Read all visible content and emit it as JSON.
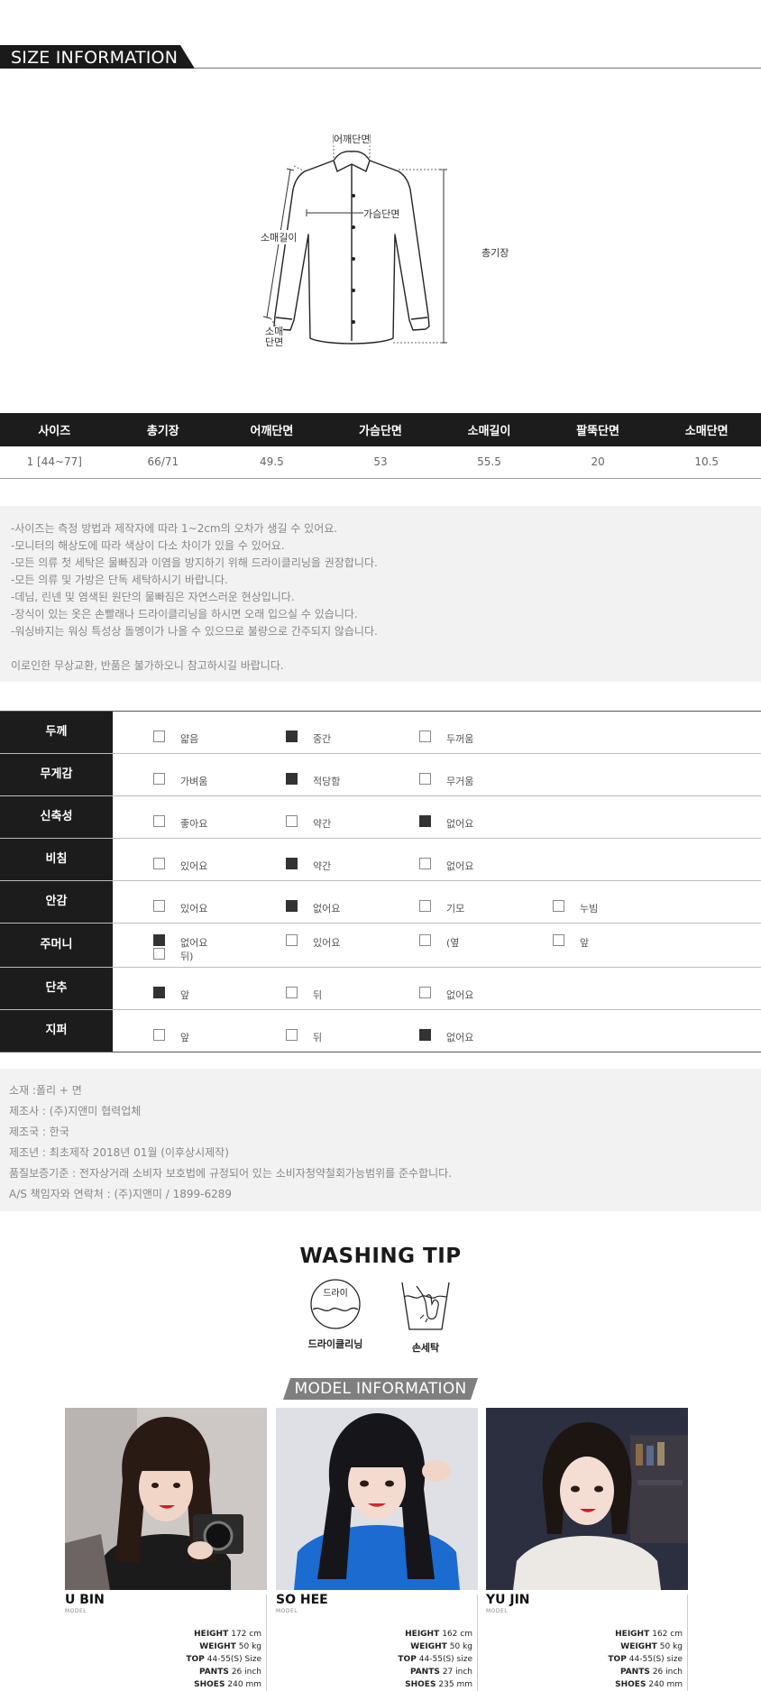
{
  "size_section": {
    "title": "SIZE INFORMATION",
    "diagram_labels": {
      "shoulder": "어깨단면",
      "chest": "가슴단면",
      "sleeve_length": "소매길이",
      "total_length": "총기장",
      "cuff": "소매\n단면"
    }
  },
  "size_table": {
    "headers": [
      "사이즈",
      "총기장",
      "어깨단면",
      "가슴단면",
      "소매길이",
      "팔뚝단면",
      "소매단면"
    ],
    "rows": [
      [
        "1 [44~77]",
        "66/71",
        "49.5",
        "53",
        "55.5",
        "20",
        "10.5"
      ]
    ]
  },
  "notes": {
    "lines": [
      "-사이즈는 측정 방법과 제작자에 따라 1~2cm의 오차가 생길 수 있어요.",
      "-모니터의 해상도에 따라 색상이 다소 차이가 있을 수 있어요.",
      "-모든 의류 첫 세탁은 물빠짐과 이염을 방지하기 위해 드라이클리닝을 권장합니다.",
      "-모든 의류 및 가방은 단독 세탁하시기 바랍니다.",
      "-데님, 린넨 및 염색된 원단의 물빠짐은 자연스러운 현상입니다.",
      "-장식이 있는 옷은 손빨래나 드라이클리닝을 하시면 오래 입으실 수 있습니다.",
      "-워싱바지는 워싱 특성상 돌멩이가 나올 수 있으므로 불량으로 간주되지 않습니다."
    ],
    "closing": "이로인한 무상교환, 반품은 불가하오니 참고하시길 바랍니다."
  },
  "attributes": [
    {
      "label": "두께",
      "options": [
        {
          "text": "얇음",
          "checked": false
        },
        {
          "text": "중간",
          "checked": true
        },
        {
          "text": "두꺼움",
          "checked": false
        }
      ]
    },
    {
      "label": "무게감",
      "options": [
        {
          "text": "가벼움",
          "checked": false
        },
        {
          "text": "적당함",
          "checked": true
        },
        {
          "text": "무거움",
          "checked": false
        }
      ]
    },
    {
      "label": "신축성",
      "options": [
        {
          "text": "좋아요",
          "checked": false
        },
        {
          "text": "약간",
          "checked": false
        },
        {
          "text": "없어요",
          "checked": true
        }
      ]
    },
    {
      "label": "비침",
      "options": [
        {
          "text": "있어요",
          "checked": false
        },
        {
          "text": "약간",
          "checked": true
        },
        {
          "text": "없어요",
          "checked": false
        }
      ]
    },
    {
      "label": "안감",
      "options": [
        {
          "text": "있어요",
          "checked": false
        },
        {
          "text": "없어요",
          "checked": true
        },
        {
          "text": "기모",
          "checked": false
        },
        {
          "text": "누빔",
          "checked": false
        }
      ]
    },
    {
      "label": "주머니",
      "options": [
        {
          "text": "없어요",
          "checked": true
        },
        {
          "text": "있어요",
          "checked": false
        },
        {
          "text": "(옆",
          "checked": false
        },
        {
          "text": "앞",
          "checked": false
        }
      ],
      "extra": "뒤)"
    },
    {
      "label": "단추",
      "options": [
        {
          "text": "앞",
          "checked": true
        },
        {
          "text": "뒤",
          "checked": false
        },
        {
          "text": "없어요",
          "checked": false
        }
      ]
    },
    {
      "label": "지퍼",
      "options": [
        {
          "text": "앞",
          "checked": false
        },
        {
          "text": "뒤",
          "checked": false
        },
        {
          "text": "없어요",
          "checked": true
        }
      ]
    }
  ],
  "product_info": [
    "소재 :폴리 + 면",
    "제조사 : (주)지앤미 협력업체",
    "제조국 : 한국",
    "제조년 : 최초제작 2018년 01월 (이후상시제작)",
    "품질보증기준 : 전자상거래 소비자 보호법에 규정되어 있는 소비자청약철회가능범위를 준수합니다.",
    "A/S 책임자와 연락처 : (주)지앤미 / 1899-6289"
  ],
  "washing": {
    "title": "WASHING TIP",
    "dry_icon_text": "드라이",
    "items": [
      {
        "icon": "dry-clean-icon",
        "label": "드라이클리닝"
      },
      {
        "icon": "hand-wash-icon",
        "label": "손세탁"
      }
    ]
  },
  "models_section": {
    "title": "MODEL INFORMATION",
    "stat_labels": [
      "HEIGHT",
      "WEIGHT",
      "TOP",
      "PANTS",
      "SHOES"
    ],
    "models": [
      {
        "name": "U BIN",
        "sub": "MODEL",
        "height": "172 cm",
        "weight": "50 kg",
        "top": "44-55(S) Size",
        "pants": "26 inch",
        "shoes": "240 mm",
        "bg": "#c9c4c4",
        "top_color": "#1b1b1b",
        "hair": "#2a1a14"
      },
      {
        "name": "SO HEE",
        "sub": "MODEL",
        "height": "162 cm",
        "weight": "50 kg",
        "top": "44-55(S) size",
        "pants": "27 inch",
        "shoes": "235 mm",
        "bg": "#dfe0e6",
        "top_color": "#1b6bd1",
        "hair": "#15151a"
      },
      {
        "name": "YU JIN",
        "sub": "MODEL",
        "height": "162 cm",
        "weight": "50 kg",
        "top": "44-55(S) size",
        "pants": "26 inch",
        "shoes": "240 mm",
        "bg": "#2c2f3f",
        "top_color": "#e8e6e2",
        "hair": "#1d1512"
      }
    ]
  }
}
